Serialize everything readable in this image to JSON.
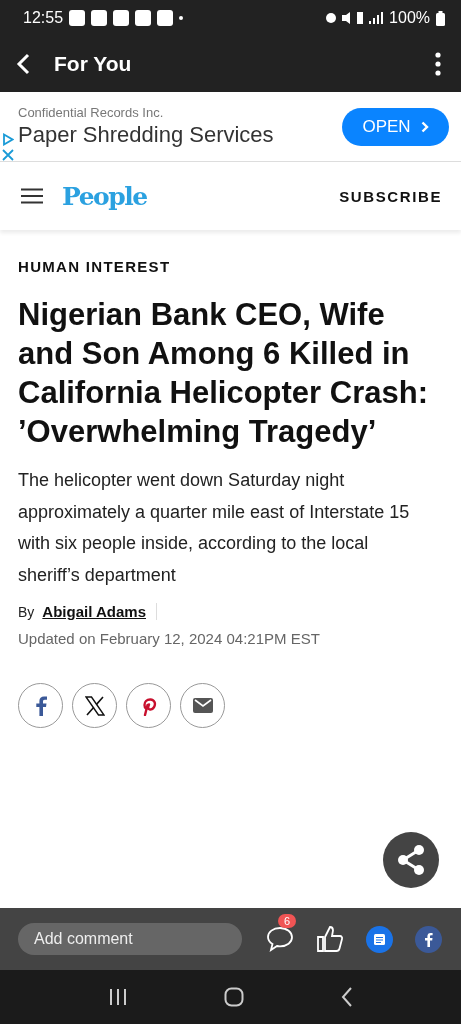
{
  "status_bar": {
    "time": "12:55",
    "battery": "100%"
  },
  "app_bar": {
    "title": "For You"
  },
  "ad": {
    "advertiser": "Confidential Records Inc.",
    "headline": "Paper Shredding Services",
    "button": "OPEN"
  },
  "site_header": {
    "logo": "People",
    "subscribe": "SUBSCRIBE"
  },
  "article": {
    "category": "HUMAN INTEREST",
    "headline": "Nigerian Bank CEO, Wife and Son Among 6 Killed in California Helicopter Crash: ’Overwhelming Tragedy’",
    "summary": "The helicopter went down Saturday night approximately a quarter mile east of Interstate 15 with six people inside, according to the local sheriff’s department",
    "by": "By",
    "author": "Abigail Adams",
    "updated": "Updated on February 12, 2024 04:21PM EST",
    "share_buttons": [
      {
        "kind": "facebook"
      },
      {
        "kind": "x"
      },
      {
        "kind": "pinterest"
      },
      {
        "kind": "email"
      }
    ]
  },
  "comment_bar": {
    "placeholder": "Add comment",
    "comment_count": "6"
  }
}
